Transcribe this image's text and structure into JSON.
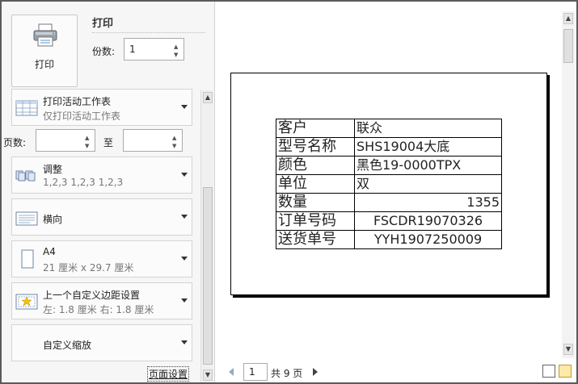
{
  "print": {
    "button_label": "打印",
    "section_title": "打印",
    "copies_label": "份数:",
    "copies_value": "1"
  },
  "options": [
    {
      "title": "打印活动工作表",
      "subtitle": "仅打印活动工作表",
      "icon": "sheet-icon"
    },
    {
      "title": "调整",
      "subtitle": "1,2,3    1,2,3    1,2,3",
      "icon": "collate-icon"
    },
    {
      "title": "横向",
      "subtitle": "",
      "icon": "landscape-icon"
    },
    {
      "title": "A4",
      "subtitle": "21 厘米 x 29.7 厘米",
      "icon": "paper-size-icon"
    },
    {
      "title": "上一个自定义边距设置",
      "subtitle": "左:  1.8 厘米    右:  1.8 厘米",
      "icon": "margins-icon"
    },
    {
      "title": "自定义缩放",
      "subtitle": "",
      "icon": ""
    }
  ],
  "pages": {
    "label": "页数:",
    "to_label": "至",
    "from_value": "",
    "to_value": ""
  },
  "page_setup_link": "页面设置",
  "preview": {
    "rows": [
      {
        "key": "客户",
        "value": "联众",
        "align": "left"
      },
      {
        "key": "型号名称",
        "value": "SHS19004大底",
        "align": "left"
      },
      {
        "key": "颜色",
        "value": "黑色19-0000TPX",
        "align": "left"
      },
      {
        "key": "单位",
        "value": "双",
        "align": "left"
      },
      {
        "key": "数量",
        "value": "1355",
        "align": "right"
      },
      {
        "key": "订单号码",
        "value": "FSCDR19070326",
        "align": "center"
      },
      {
        "key": "送货单号",
        "value": "YYH1907250009",
        "align": "center"
      }
    ]
  },
  "navigation": {
    "current_page": "1",
    "total_pages": "共 9 页"
  }
}
